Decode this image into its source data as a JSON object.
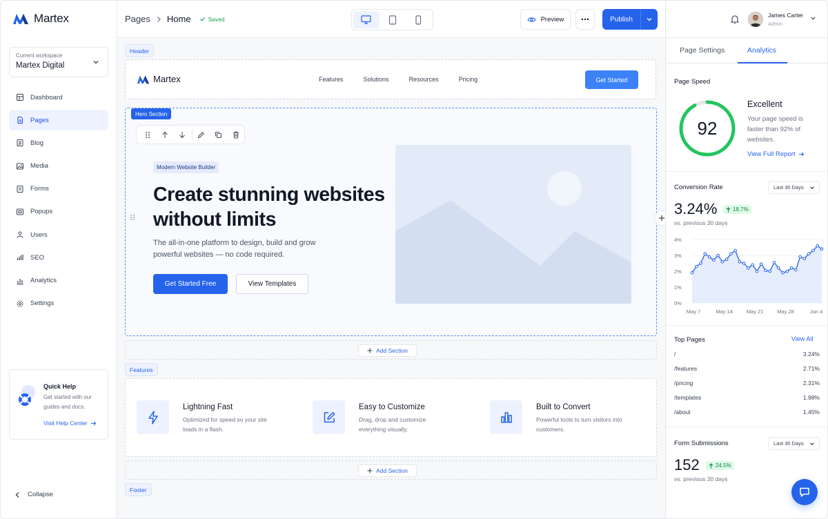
{
  "brand": {
    "name": "Martex"
  },
  "workspace": {
    "caption": "Current workspace",
    "name": "Martex Digital"
  },
  "nav": [
    {
      "label": "Dashboard",
      "icon": "dashboard-icon",
      "active": false
    },
    {
      "label": "Pages",
      "icon": "page-icon",
      "active": true
    },
    {
      "label": "Blog",
      "icon": "blog-icon",
      "active": false
    },
    {
      "label": "Media",
      "icon": "image-icon",
      "active": false
    },
    {
      "label": "Forms",
      "icon": "form-icon",
      "active": false
    },
    {
      "label": "Popups",
      "icon": "popup-icon",
      "active": false
    },
    {
      "label": "Users",
      "icon": "users-icon",
      "active": false
    },
    {
      "label": "SEO",
      "icon": "seo-chart-icon",
      "active": false
    },
    {
      "label": "Analytics",
      "icon": "analytics-icon",
      "active": false
    },
    {
      "label": "Settings",
      "icon": "gear-icon",
      "active": false
    }
  ],
  "help": {
    "title": "Quick Help",
    "desc": "Get started with our guides and docs.",
    "link": "Visit Help Center"
  },
  "collapse": "Collapse",
  "topbar": {
    "crumb_parent": "Pages",
    "crumb_current": "Home",
    "saved": "Saved",
    "preview": "Preview",
    "publish": "Publish"
  },
  "canvas": {
    "header_tag": "Header",
    "header": {
      "logo": "Martex",
      "links": [
        "Features",
        "Solutions",
        "Resources",
        "Pricing"
      ],
      "cta": "Get Started"
    },
    "hero_tag": "Hero Section",
    "hero": {
      "badge": "Modern Website Builder",
      "title": "Create stunning websites without limits",
      "subtitle": "The all-in-one platform to design, build and grow powerful websites — no code required.",
      "primary": "Get Started Free",
      "secondary": "View Templates"
    },
    "add_section": "Add Section",
    "features_tag": "Features",
    "features": [
      {
        "title": "Lightning Fast",
        "desc": "Optimized for speed so your site loads in a flash.",
        "icon": "bolt-icon"
      },
      {
        "title": "Easy to Customize",
        "desc": "Drag, drop and customize everything visually.",
        "icon": "edit-icon"
      },
      {
        "title": "Built to Convert",
        "desc": "Powerful tools to turn visitors into customers.",
        "icon": "bar-chart-icon"
      }
    ],
    "footer_tag": "Footer"
  },
  "user": {
    "name": "James Carter",
    "role": "Admin"
  },
  "panel": {
    "tabs": [
      "Page Settings",
      "Analytics"
    ],
    "active_tab": 1,
    "speed": {
      "title": "Page Speed",
      "score": "92",
      "score_value": 92,
      "label": "Excellent",
      "desc": "Your page speed is faster than 92% of websites.",
      "link": "View Full Report"
    },
    "conversion": {
      "title": "Conversion Rate",
      "range": "Last 30 Days",
      "value": "3.24%",
      "delta": "18.7%",
      "compare": "vs. previous 30 days"
    },
    "top_pages": {
      "title": "Top Pages",
      "link": "View All",
      "rows": [
        {
          "path": "/",
          "value": "3.24%"
        },
        {
          "path": "/features",
          "value": "2.71%"
        },
        {
          "path": "/pricing",
          "value": "2.31%"
        },
        {
          "path": "/templates",
          "value": "1.98%"
        },
        {
          "path": "/about",
          "value": "1.45%"
        }
      ]
    },
    "forms": {
      "title": "Form Submissions",
      "range": "Last 30 Days",
      "value": "152",
      "delta": "24.5%",
      "compare": "vs. previous 30 days"
    }
  },
  "chart_data": {
    "type": "area",
    "y_ticks": [
      "4%",
      "3%",
      "2%",
      "1%",
      "0%"
    ],
    "x_ticks": [
      "May 7",
      "May 14",
      "May 21",
      "May 28",
      "Jun 4"
    ],
    "ylim": [
      0,
      4
    ],
    "values": [
      1.9,
      2.3,
      2.5,
      3.1,
      2.9,
      2.7,
      3.0,
      2.6,
      2.75,
      3.1,
      3.3,
      2.6,
      2.5,
      2.2,
      2.4,
      2.0,
      2.45,
      2.05,
      2.0,
      2.55,
      2.2,
      1.9,
      2.0,
      2.2,
      2.1,
      2.9,
      2.8,
      3.1,
      3.3,
      3.6,
      3.4
    ]
  },
  "colors": {
    "accent": "#2563eb",
    "success": "#22c55e"
  }
}
